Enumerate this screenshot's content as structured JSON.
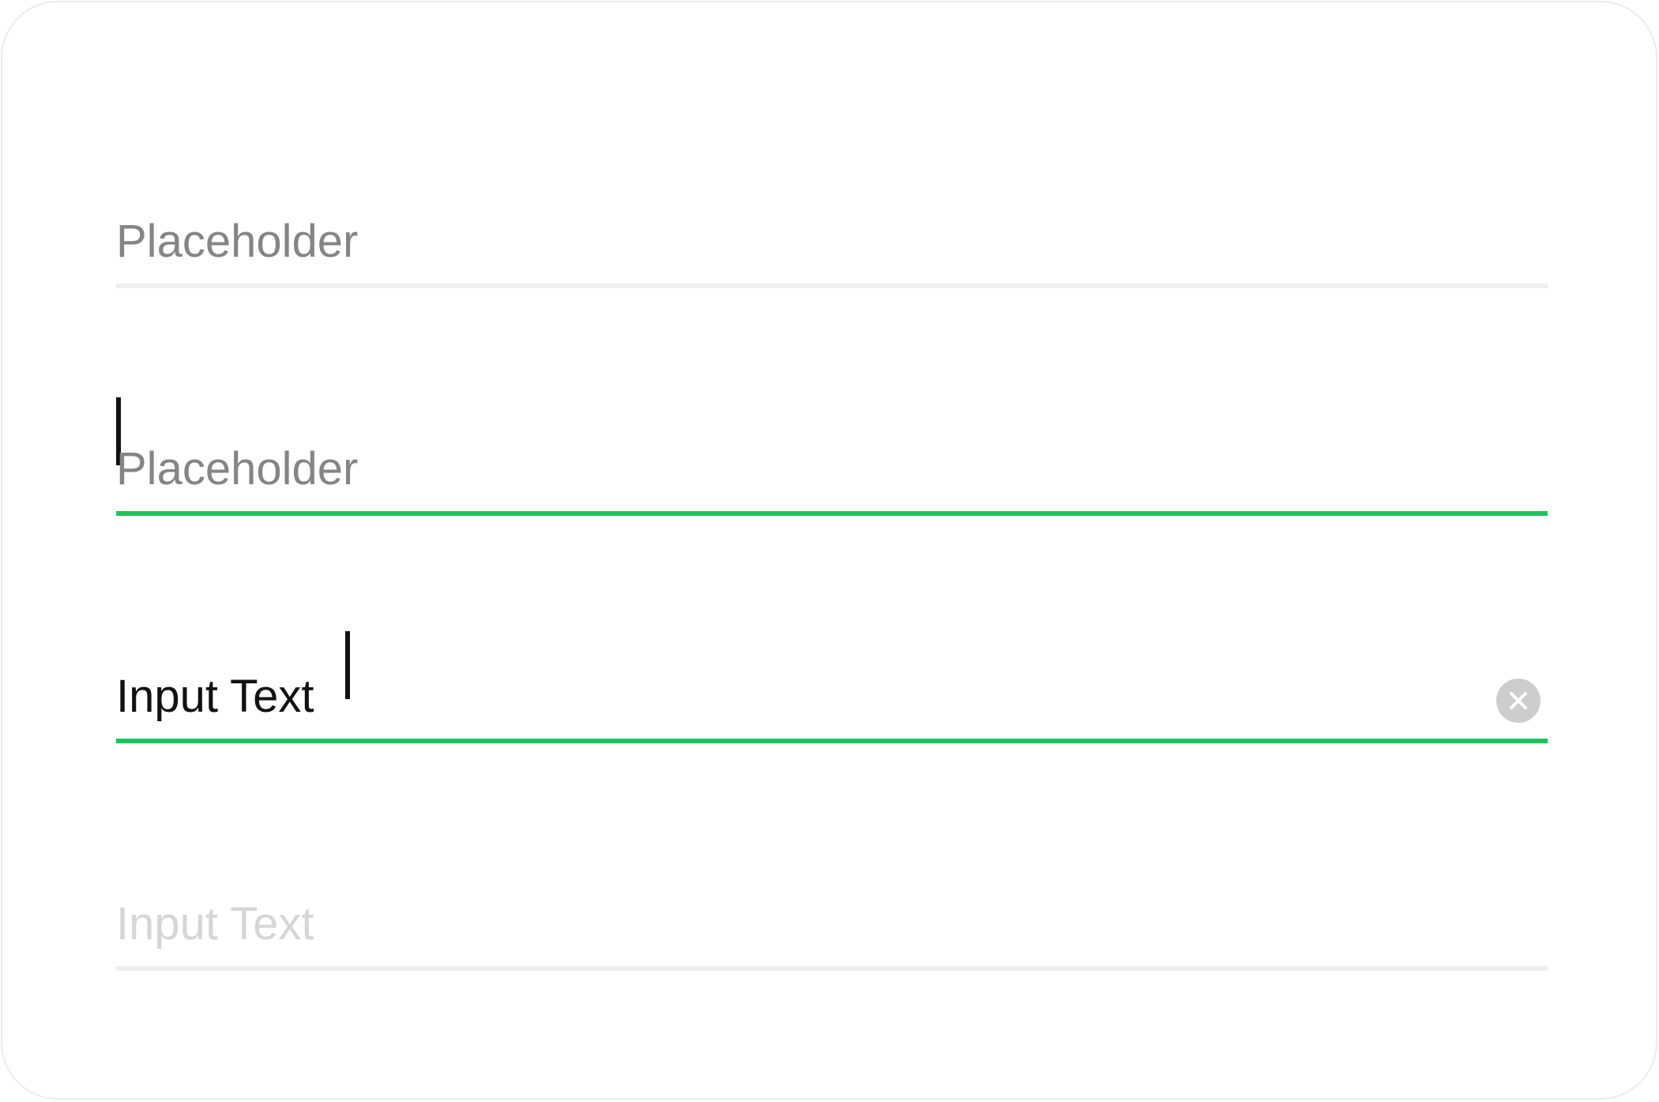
{
  "fields": [
    {
      "state": "default",
      "placeholder": "Placeholder",
      "value": ""
    },
    {
      "state": "focused",
      "placeholder": "Placeholder",
      "value": ""
    },
    {
      "state": "filled-focused",
      "placeholder": "",
      "value": "Input Text",
      "clear_icon": "clear-circle-icon"
    },
    {
      "state": "disabled",
      "placeholder": "",
      "value": "Input Text"
    }
  ],
  "colors": {
    "accent": "#1cc35c",
    "underline_idle": "#eeeeee",
    "placeholder": "#858585",
    "text": "#111111",
    "disabled_text": "#d6d6d6",
    "clear_button": "#cdcdcd"
  }
}
